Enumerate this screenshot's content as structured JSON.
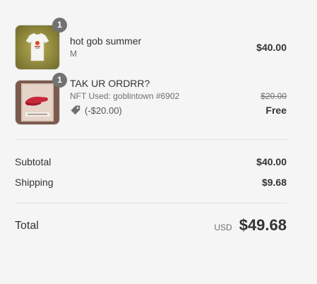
{
  "order_summary": {
    "items": [
      {
        "quantity": "1",
        "name": "hot gob summer",
        "variant": "M",
        "price": "$40.00",
        "image": "white-tshirt-product-image"
      },
      {
        "quantity": "1",
        "name": "TAK UR ORDRR?",
        "variant": "NFT Used: goblintown #6902",
        "original_price": "$20.00",
        "price": "Free",
        "discount": "(-$20.00)",
        "discount_icon": "tag-icon",
        "image": "red-visor-product-image"
      }
    ],
    "subtotal_label": "Subtotal",
    "subtotal_value": "$40.00",
    "shipping_label": "Shipping",
    "shipping_value": "$9.68",
    "total_label": "Total",
    "currency": "USD",
    "total_value": "$49.68"
  },
  "colors": {
    "background": "#f5f5f5",
    "text": "#333333",
    "muted": "#707070",
    "badge": "#727272",
    "divider": "#e1e1e1"
  }
}
